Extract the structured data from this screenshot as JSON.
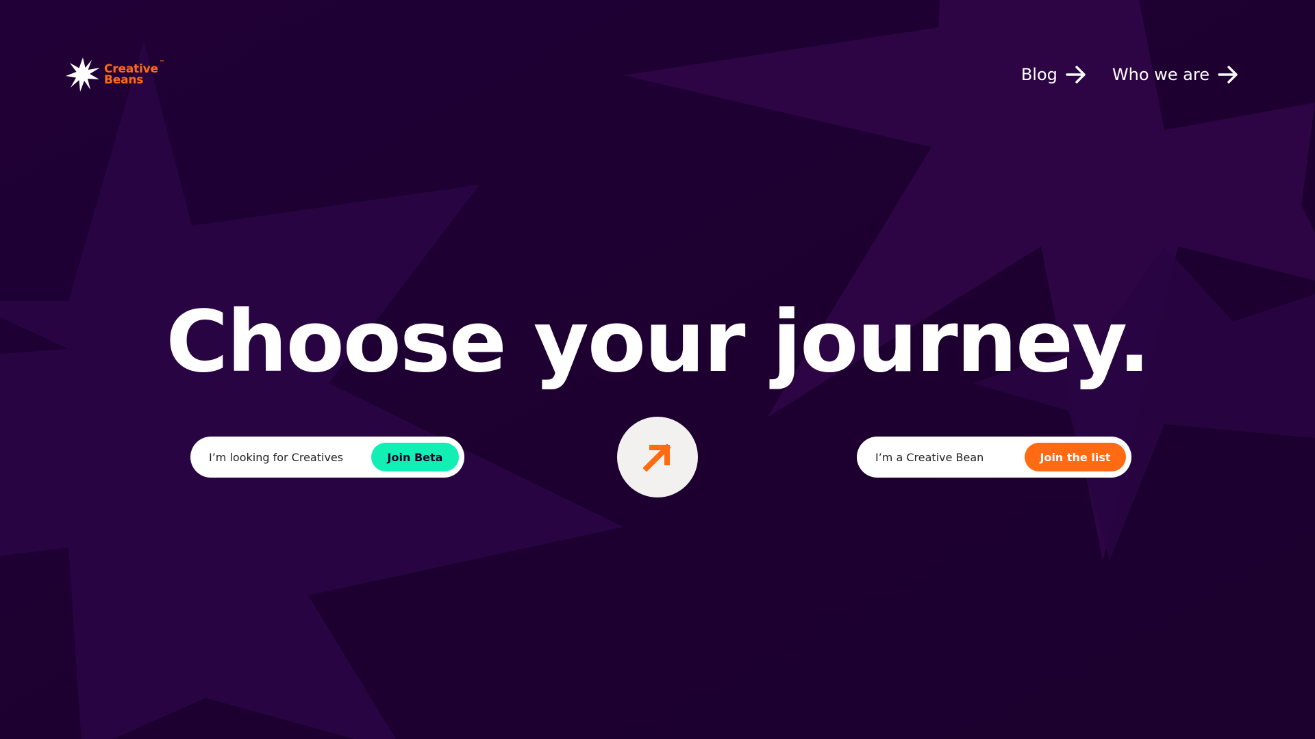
{
  "brand": {
    "name_line1": "Creative",
    "name_line2": "Beans",
    "trademark": "™",
    "accent_color": "#ff6a13",
    "background_color": "#1f0033"
  },
  "nav": {
    "links": [
      {
        "label": "Blog",
        "icon": "arrow-right-icon"
      },
      {
        "label": "Who we are",
        "icon": "arrow-right-icon"
      }
    ]
  },
  "hero": {
    "headline": "Choose your journey."
  },
  "journeys": {
    "left": {
      "label": "I’m looking for Creatives",
      "button": "Join Beta",
      "button_color": "#12efb4"
    },
    "right": {
      "label": "I’m a Creative Bean",
      "button": "Join the list",
      "button_color": "#ff6a13"
    },
    "center_icon": "arrow-up-right-icon"
  }
}
